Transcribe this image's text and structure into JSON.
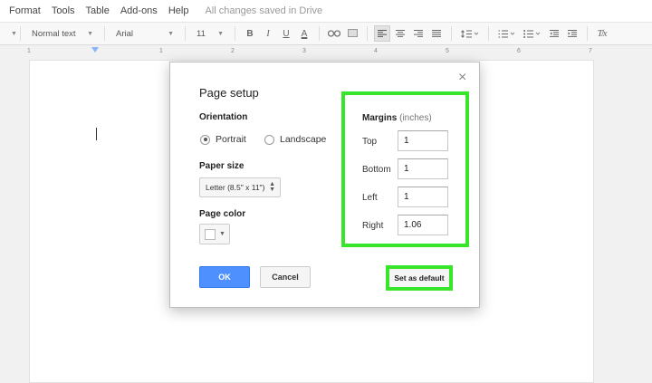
{
  "menubar": {
    "items": [
      "Format",
      "Tools",
      "Table",
      "Add-ons",
      "Help"
    ],
    "status": "All changes saved in Drive"
  },
  "toolbar": {
    "style": "Normal text",
    "font": "Arial",
    "size": "11",
    "bold": "B",
    "italic": "I",
    "underline": "U",
    "text_color": "A",
    "clear_format": "T̸x"
  },
  "ruler": {
    "ticks": [
      "1",
      "1",
      "2",
      "3",
      "4",
      "5",
      "6",
      "7"
    ]
  },
  "dialog": {
    "title": "Page setup",
    "close": "×",
    "orientation": {
      "label": "Orientation",
      "portrait": "Portrait",
      "landscape": "Landscape",
      "selected": "Portrait"
    },
    "paper_size": {
      "label": "Paper size",
      "value": "Letter (8.5\" x 11\")"
    },
    "page_color": {
      "label": "Page color",
      "value": "#ffffff"
    },
    "margins": {
      "label": "Margins",
      "unit": "(inches)",
      "top_label": "Top",
      "top": "1",
      "bottom_label": "Bottom",
      "bottom": "1",
      "left_label": "Left",
      "left": "1",
      "right_label": "Right",
      "right": "1.06"
    },
    "ok": "OK",
    "cancel": "Cancel",
    "set_default": "Set as default"
  },
  "colors": {
    "highlight": "#39e52b",
    "primary": "#4d90fe"
  }
}
